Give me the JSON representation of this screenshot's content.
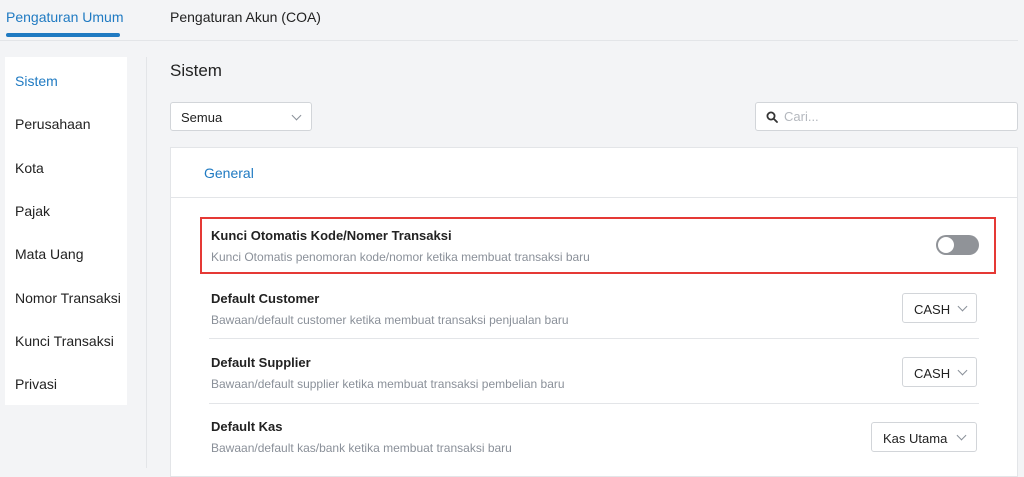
{
  "top_tabs": [
    {
      "label": "Pengaturan Umum",
      "active": true
    },
    {
      "label": "Pengaturan Akun (COA)",
      "active": false
    }
  ],
  "sidebar": {
    "items": [
      {
        "label": "Sistem",
        "active": true
      },
      {
        "label": "Perusahaan"
      },
      {
        "label": "Kota"
      },
      {
        "label": "Pajak"
      },
      {
        "label": "Mata Uang"
      },
      {
        "label": "Nomor Transaksi"
      },
      {
        "label": "Kunci Transaksi"
      },
      {
        "label": "Privasi"
      }
    ]
  },
  "main": {
    "title": "Sistem",
    "filter": {
      "selected": "Semua"
    },
    "search": {
      "placeholder": "Cari..."
    },
    "card": {
      "header": "General",
      "settings": [
        {
          "title": "Kunci Otomatis Kode/Nomer Transaksi",
          "description": "Kunci Otomatis penomoran kode/nomor ketika membuat transaksi baru",
          "control": "toggle",
          "toggle_on": false,
          "highlighted": true
        },
        {
          "title": "Default Customer",
          "description": "Bawaan/default customer ketika membuat transaksi penjualan baru",
          "control": "select",
          "value": "CASH"
        },
        {
          "title": "Default Supplier",
          "description": "Bawaan/default supplier ketika membuat transaksi pembelian baru",
          "control": "select",
          "value": "CASH"
        },
        {
          "title": "Default Kas",
          "description": "Bawaan/default kas/bank ketika membuat transaksi baru",
          "control": "select",
          "value": "Kas Utama"
        }
      ]
    }
  },
  "colors": {
    "accent": "#1f7ac2",
    "highlight_border": "#e53935",
    "toggle_off": "#909398"
  },
  "icons": {
    "search": "search-icon",
    "dropdown": "chevron-down-icon"
  }
}
